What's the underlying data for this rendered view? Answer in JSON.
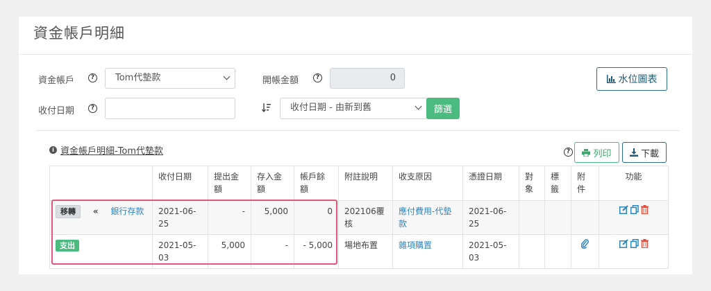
{
  "page": {
    "title": "資金帳戶明細"
  },
  "filters": {
    "account_label": "資金帳戶",
    "account_value": "Tom代墊款",
    "opening_label": "開帳金額",
    "opening_value": "0",
    "date_label": "收付日期",
    "date_value": "",
    "sort_value": "收付日期 - 由新到舊",
    "filter_button": "篩選",
    "chart_button": "水位圖表"
  },
  "section": {
    "title": "資金帳戶明細-Tom代墊款",
    "print_button": "列印",
    "download_button": "下載"
  },
  "table": {
    "headers": [
      "",
      "收付日期",
      "提出金額",
      "存入金額",
      "帳戶餘額",
      "附註說明",
      "收支原因",
      "憑證日期",
      "對象",
      "標籤",
      "附件",
      "功能"
    ],
    "rows": [
      {
        "badge": "移轉",
        "arrow": "«",
        "account": "銀行存款",
        "date": "2021-06-25",
        "withdraw": "-",
        "deposit": "5,000",
        "balance": "0",
        "note": "202106覆核",
        "reason": "應付費用-代墊款",
        "voucher_date": "2021-06-25",
        "target": "",
        "tags": ""
      },
      {
        "badge": "支出",
        "date": "2021-05-03",
        "withdraw": "5,000",
        "deposit": "-",
        "balance": "- 5,000",
        "note": "場地布置",
        "reason": "雜項購置",
        "voucher_date": "2021-05-03",
        "target": "",
        "tags": ""
      }
    ]
  },
  "colors": {
    "accent_green": "#4cbb7f",
    "link_blue": "#2e86c1",
    "highlight_pink": "#e0577a",
    "delete_red": "#e74c3c"
  },
  "icons": [
    "help-icon",
    "chevron-down-icon",
    "sort-desc-icon",
    "bar-chart-icon",
    "info-icon",
    "printer-icon",
    "download-icon",
    "paperclip-icon",
    "edit-icon",
    "copy-icon",
    "trash-icon"
  ]
}
